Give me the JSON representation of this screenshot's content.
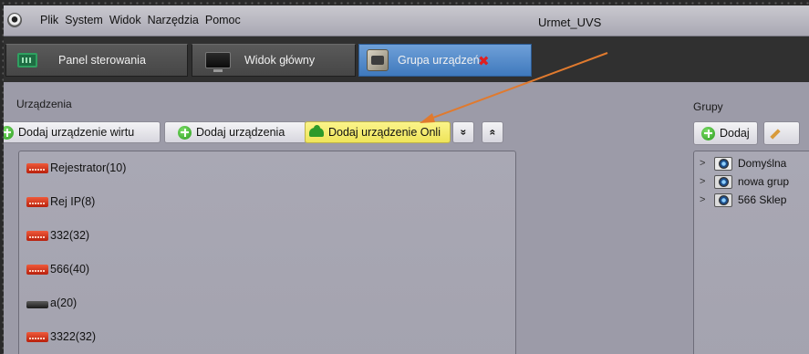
{
  "window": {
    "title": "Urmet_UVS"
  },
  "menu": {
    "items": [
      "Plik",
      "System",
      "Widok",
      "Narzędzia",
      "Pomoc"
    ]
  },
  "tabs": [
    {
      "label": "Panel sterowania",
      "icon": "control-panel-icon"
    },
    {
      "label": "Widok główny",
      "icon": "monitor-icon"
    },
    {
      "label": "Grupa urządzeń",
      "icon": "device-group-icon",
      "active": true,
      "closable": true
    }
  ],
  "devices": {
    "title": "Urządzenia",
    "toolbar": {
      "add_virtual": "Dodaj urządzenie wirtu",
      "add_devices": "Dodaj urządzenia",
      "add_online": "Dodaj urządzenie Onli",
      "expand_label": "»",
      "collapse_label": "«"
    },
    "items": [
      {
        "label": "Rejestrator(10)",
        "icon": "dvr-icon"
      },
      {
        "label": "Rej IP(8)",
        "icon": "dvr-icon"
      },
      {
        "label": "332(32)",
        "icon": "dvr-icon"
      },
      {
        "label": "566(40)",
        "icon": "dvr-icon"
      },
      {
        "label": "a(20)",
        "icon": "nvr-icon"
      },
      {
        "label": "3322(32)",
        "icon": "dvr-icon"
      }
    ]
  },
  "groups": {
    "title": "Grupy",
    "add_label": "Dodaj",
    "items": [
      {
        "label": "Domyślna"
      },
      {
        "label": "nowa grup"
      },
      {
        "label": "566 Sklep"
      }
    ]
  },
  "colors": {
    "accent_tab": "#4a85c8",
    "highlight_button": "#f2e86a",
    "annotation_arrow": "#e07a2e",
    "close_icon": "#e02020"
  }
}
